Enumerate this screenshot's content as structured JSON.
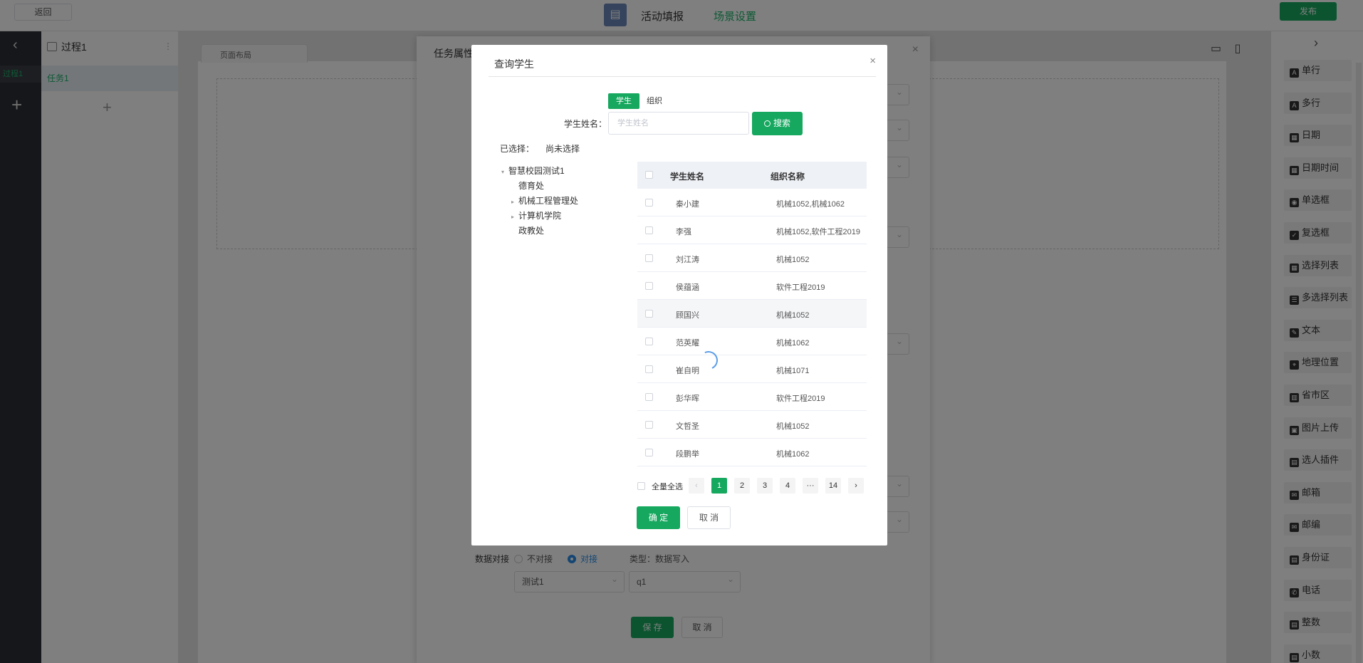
{
  "topbar": {
    "back_label": "返回",
    "tab_fill": "活动填报",
    "tab_scene": "场景设置",
    "publish_label": "发布"
  },
  "leftbar": {
    "arrow": "‹",
    "item": "过程1",
    "plus": "+"
  },
  "process_panel": {
    "title": "过程1",
    "task": "任务1",
    "plus": "+"
  },
  "canvas": {
    "page_tab": "页面布局"
  },
  "task_dialog": {
    "title": "任务属性",
    "dock_label": "数据对接",
    "dock_no": "不对接",
    "dock_yes": "对接",
    "type_text": "类型：数据写入",
    "select1": "测试1",
    "select2": "q1",
    "save_label": "保 存",
    "cancel_label": "取 消"
  },
  "right_panel": {
    "arrow": "›",
    "components": [
      {
        "label": "单行",
        "icon": "single-line-icon"
      },
      {
        "label": "多行",
        "icon": "multi-line-icon"
      },
      {
        "label": "日期",
        "icon": "calendar-icon"
      },
      {
        "label": "日期时间",
        "icon": "calendar-time-icon"
      },
      {
        "label": "单选框",
        "icon": "radio-icon"
      },
      {
        "label": "复选框",
        "icon": "checkbox-icon"
      },
      {
        "label": "选择列表",
        "icon": "grid-icon"
      },
      {
        "label": "多选择列表",
        "icon": "list-icon"
      },
      {
        "label": "文本",
        "icon": "text-icon"
      },
      {
        "label": "地理位置",
        "icon": "location-icon"
      },
      {
        "label": "省市区",
        "icon": "map-icon"
      },
      {
        "label": "图片上传",
        "icon": "image-upload-icon"
      },
      {
        "label": "选人插件",
        "icon": "person-picker-icon"
      },
      {
        "label": "邮箱",
        "icon": "mail-icon"
      },
      {
        "label": "邮编",
        "icon": "postcode-icon"
      },
      {
        "label": "身份证",
        "icon": "id-card-icon"
      },
      {
        "label": "电话",
        "icon": "phone-icon"
      },
      {
        "label": "整数",
        "icon": "integer-icon"
      },
      {
        "label": "小数",
        "icon": "decimal-icon"
      }
    ]
  },
  "modal": {
    "title": "查询学生",
    "close": "×",
    "tabs": {
      "student": "学生",
      "org": "组织"
    },
    "name_label": "学生姓名：",
    "name_placeholder": "学生姓名",
    "search_label": "搜索",
    "selected_label": "已选择：",
    "selected_value": "尚未选择",
    "tree": [
      {
        "label": "智慧校园测试1",
        "arrow": "▾",
        "level": 0
      },
      {
        "label": "德育处",
        "arrow": "",
        "level": 1
      },
      {
        "label": "机械工程管理处",
        "arrow": "▸",
        "level": 1
      },
      {
        "label": "计算机学院",
        "arrow": "▸",
        "level": 1
      },
      {
        "label": "政教处",
        "arrow": "",
        "level": 1
      }
    ],
    "table": {
      "columns": [
        "学生姓名",
        "组织名称"
      ],
      "rows": [
        {
          "name": "秦小建",
          "org": "机械1052,机械1062"
        },
        {
          "name": "李强",
          "org": "机械1052,软件工程2019"
        },
        {
          "name": "刘江涛",
          "org": "机械1052"
        },
        {
          "name": "侯蕴涵",
          "org": "软件工程2019"
        },
        {
          "name": "顾国兴",
          "org": "机械1052"
        },
        {
          "name": "范英耀",
          "org": "机械1062"
        },
        {
          "name": "崔自明",
          "org": "机械1071"
        },
        {
          "name": "彭华晖",
          "org": "软件工程2019"
        },
        {
          "name": "文哲圣",
          "org": "机械1052"
        },
        {
          "name": "段鹏举",
          "org": "机械1062"
        }
      ]
    },
    "pager": {
      "select_all": "全量全选",
      "prev": "‹",
      "pages": [
        "1",
        "2",
        "3",
        "4",
        "···",
        "14"
      ],
      "active": "1",
      "next": "›"
    },
    "ok_label": "确 定",
    "cancel_label": "取 消"
  },
  "colors": {
    "accent": "#16a85f",
    "overlay": "rgba(0,0,0,0.5)",
    "link_blue": "#2b8de6"
  }
}
